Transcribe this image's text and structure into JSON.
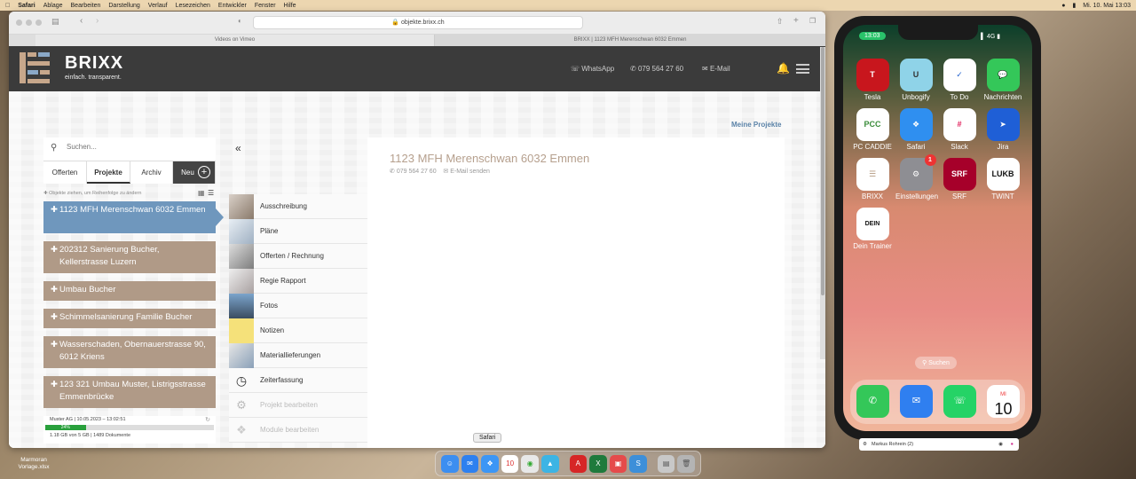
{
  "menubar": {
    "items": [
      "Safari",
      "Ablage",
      "Bearbeiten",
      "Darstellung",
      "Verlauf",
      "Lesezeichen",
      "Entwickler",
      "Fenster",
      "Hilfe"
    ],
    "clock": "Mi. 10. Mai  13:03"
  },
  "browser": {
    "url": "objekte.brixx.ch",
    "tabs": [
      "Videos on Vimeo",
      "BRIXX | 1123 MFH Merenschwan 6032 Emmen"
    ]
  },
  "site": {
    "brand": "BRIXX",
    "tagline": "einfach. transparent.",
    "links": {
      "whatsapp": "WhatsApp",
      "phone": "079 564 27 60",
      "email": "E-Mail"
    },
    "meine_projekte": "Meine Projekte"
  },
  "leftpanel": {
    "search_placeholder": "Suchen...",
    "tabs": [
      "Offerten",
      "Projekte",
      "Archiv"
    ],
    "new_label": "Neu",
    "hint": "Objekte ziehen, um Reihenfolge zu ändern",
    "projects": [
      "1123 MFH Merenschwan 6032 Emmen",
      "202312 Sanierung Bucher, Kellerstrasse Luzern",
      "Umbau Bucher",
      "Schimmelsanierung Familie Bucher",
      "Wasserschaden, Obernauerstrasse 90, 6012 Kriens",
      "123 321 Umbau Muster, Listrigsstrasse Emmenbrücke"
    ],
    "status": {
      "line1": "Muster AG | 10.05.2023 – 13:02:51",
      "progress_label": "24%",
      "progress": 0.24,
      "line2": "1.18 GB von 5 GB | 1489 Dokumente"
    }
  },
  "menu": {
    "collapse": "«",
    "items": [
      "Ausschreibung",
      "Pläne",
      "Offerten / Rechnung",
      "Regie Rapport",
      "Fotos",
      "Notizen",
      "Materiallieferungen",
      "Zeiterfassung",
      "Projekt bearbeiten",
      "Module bearbeiten"
    ]
  },
  "detail": {
    "title": "1123 MFH Merenschwan 6032 Emmen",
    "phone": "079 564 27 60",
    "email": "E-Mail senden"
  },
  "dock_tooltip": "Safari",
  "desktop_file": "Marmoran Vorlage.xlsx",
  "phone": {
    "time": "13:03",
    "signal": "4G",
    "apps": [
      {
        "name": "Tesla",
        "icon": "tesla-icon",
        "color": "#c8161d"
      },
      {
        "name": "Unbogify",
        "icon": "unbogify-icon",
        "color": "#8fd3e8"
      },
      {
        "name": "To Do",
        "icon": "todo-icon",
        "color": "#ffffff"
      },
      {
        "name": "Nachrichten",
        "icon": "messages-icon",
        "color": "#34c759"
      },
      {
        "name": "PC CADDIE",
        "icon": "pccaddie-icon",
        "color": "#ffffff"
      },
      {
        "name": "Safari",
        "icon": "safari-icon",
        "color": "#2f8ff0"
      },
      {
        "name": "Slack",
        "icon": "slack-icon",
        "color": "#ffffff"
      },
      {
        "name": "Jira",
        "icon": "jira-icon",
        "color": "#1f5fd6"
      },
      {
        "name": "BRIXX",
        "icon": "brixx-icon",
        "color": "#ffffff"
      },
      {
        "name": "Einstellungen",
        "icon": "settings-icon",
        "color": "#8e8e93",
        "badge": "1"
      },
      {
        "name": "SRF",
        "icon": "srf-icon",
        "color": "#a6002a"
      },
      {
        "name": "TWINT",
        "icon": "twint-icon",
        "color": "#ffffff"
      },
      {
        "name": "Dein Trainer",
        "icon": "trainer-icon",
        "color": "#ffffff"
      }
    ],
    "search": "Suchen",
    "dock": [
      {
        "icon": "phone-icon",
        "color": "#34c759"
      },
      {
        "icon": "mail-icon",
        "color": "#2f7ff0"
      },
      {
        "icon": "whatsapp-icon",
        "color": "#25d366"
      },
      {
        "icon": "calendar-icon",
        "color": "#ffffff",
        "day": "MI",
        "date": "10"
      }
    ],
    "bar_label": "Markus Rohrein (2)"
  }
}
